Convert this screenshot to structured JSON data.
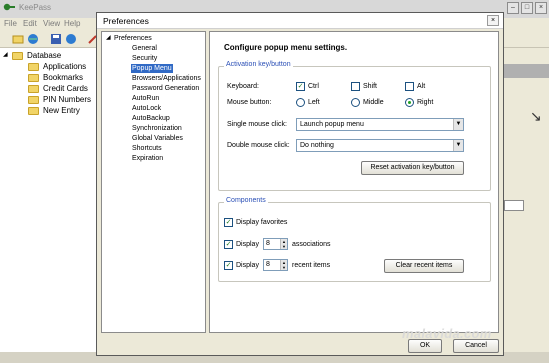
{
  "app": {
    "title": "KeePass",
    "menu": [
      "File",
      "Edit",
      "View",
      "Help"
    ],
    "tree": [
      {
        "label": "Database",
        "level": 0
      },
      {
        "label": "Applications",
        "level": 1
      },
      {
        "label": "Bookmarks",
        "level": 1
      },
      {
        "label": "Credit Cards",
        "level": 1
      },
      {
        "label": "PIN Numbers",
        "level": 1
      },
      {
        "label": "New Entry",
        "level": 1
      }
    ]
  },
  "dialog": {
    "title": "Preferences",
    "nav_root": "Preferences",
    "nav": [
      "General",
      "Security",
      "Popup Menu",
      "Browsers/Applications",
      "Password Generation",
      "AutoRun",
      "AutoLock",
      "AutoBackup",
      "Synchronization",
      "Global Variables",
      "Shortcuts",
      "Expiration"
    ],
    "selected_nav": "Popup Menu",
    "heading": "Configure popup menu settings.",
    "activation": {
      "group_title": "Activation key/button",
      "keyboard_label": "Keyboard:",
      "keys": [
        {
          "label": "Ctrl",
          "checked": true
        },
        {
          "label": "Shift",
          "checked": false
        },
        {
          "label": "Alt",
          "checked": false
        }
      ],
      "mouse_label": "Mouse button:",
      "mouse_options": [
        {
          "label": "Left",
          "selected": false
        },
        {
          "label": "Middle",
          "selected": false
        },
        {
          "label": "Right",
          "selected": true
        }
      ],
      "single_click_label": "Single mouse click:",
      "single_click_value": "Launch popup menu",
      "double_click_label": "Double mouse click:",
      "double_click_value": "Do nothing",
      "reset_button": "Reset activation key/button"
    },
    "components": {
      "group_title": "Components",
      "favorites_label": "Display favorites",
      "assoc_display": "Display",
      "assoc_value": "8",
      "assoc_label": "associations",
      "recent_display": "Display",
      "recent_value": "8",
      "recent_label": "recent items",
      "clear_button": "Clear recent items"
    },
    "ok_button": "OK",
    "cancel_button": "Cancel"
  },
  "watermark": "malavida.com",
  "colors": {
    "selection": "#316ac5",
    "group_title": "#2a4fb6",
    "accent_green": "#21a121"
  }
}
